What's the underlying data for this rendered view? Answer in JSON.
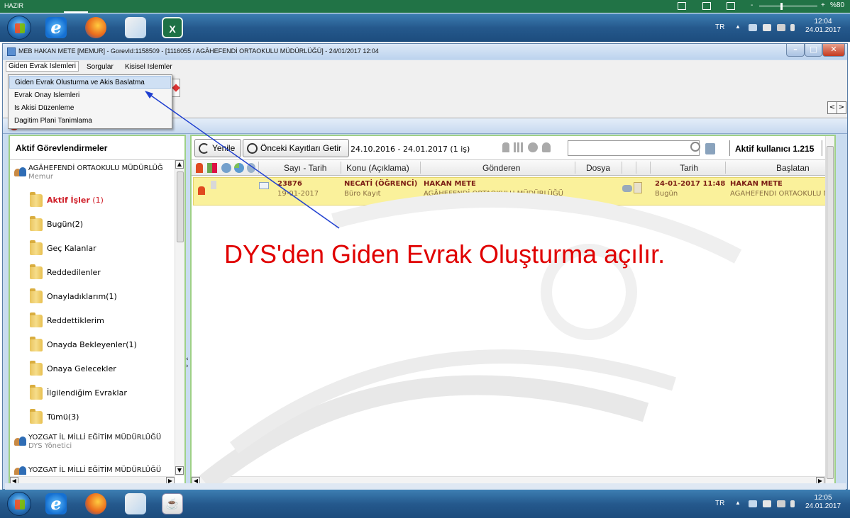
{
  "excel_status": {
    "ready": "HAZIR",
    "zoom": "%80"
  },
  "taskbar_top": {
    "lang": "TR",
    "time": "12:04",
    "date": "24.01.2017",
    "tray_caret": "▲"
  },
  "taskbar_bottom": {
    "lang": "TR",
    "time": "12:05",
    "date": "24.01.2017",
    "tray_caret": "▲"
  },
  "window": {
    "title": "MEB  HAKAN METE  [MEMUR] - GorevId:1158509 - [1116055 / AGÂHEFENDİ ORTAOKULU MÜDÜRLÜĞÜ] - 24/01/2017 12:04"
  },
  "menubar": {
    "items": [
      "Giden Evrak Islemleri",
      "Sorgular",
      "Kisisel Islemler"
    ]
  },
  "dropdown": {
    "items": [
      "Giden Evrak Olusturma ve Akis Baslatma",
      "Evrak Onay Islemleri",
      "Is Akisi Düzenleme",
      "Dagitim Plani Tanimlama"
    ]
  },
  "left_panel": {
    "title": "Aktif Görevlendirmeler",
    "unit_1": {
      "name": "AGÂHEFENDİ ORTAOKULU MÜDÜRLÜĞ",
      "role": "Memur"
    },
    "folders": [
      {
        "label": "Aktif İşler",
        "count": "(1)"
      },
      {
        "label": "Bugün(2)"
      },
      {
        "label": "Geç Kalanlar"
      },
      {
        "label": "Reddedilenler"
      },
      {
        "label": "Onayladıklarım(1)"
      },
      {
        "label": "Reddettiklerim"
      },
      {
        "label": "Onayda Bekleyenler(1)"
      },
      {
        "label": "Onaya Gelecekler"
      },
      {
        "label": "İlgilendiğim Evraklar"
      },
      {
        "label": "Tümü(3)"
      }
    ],
    "unit_2": {
      "name": "YOZGAT İL MİLLİ EĞİTİM MÜDÜRLÜĞÜ",
      "role": "DYS Yönetici"
    },
    "unit_3": {
      "name": "YOZGAT İL MİLLİ EĞİTİM MÜDÜRLÜĞÜ"
    }
  },
  "right_panel": {
    "refresh_label": "Yenile",
    "prev_records_label": "Önceki Kayıtları Getir",
    "date_range": "24.10.2016 - 24.01.2017 (1 iş)",
    "active_users": "Aktif kullanıcı 1.215",
    "columns": [
      "Sayı - Tarih",
      "Konu (Açıklama)",
      "Gönderen",
      "Dosya",
      "Tarih",
      "Başlatan"
    ],
    "row": {
      "number": "23876",
      "number_date": "19-01-2017",
      "subject": "NECATİ  (ÖĞRENCİ)",
      "subject_sub": "Büro Kayıt",
      "sender": "HAKAN METE",
      "sender_unit": "AGÂHEFENDİ ORTAOKULU MÜDÜRLÜĞÜ",
      "date": "24-01-2017 11:48",
      "date_sub": "Bugün",
      "starter": "HAKAN METE",
      "starter_unit": "AGÂHEFENDİ ORTAOKULU M"
    }
  },
  "annotation": {
    "text": "DYS'den Giden Evrak Oluşturma açılır.",
    "color": "#e00000"
  },
  "colors": {
    "excel_green": "#217346",
    "row_highlight": "#faf19b",
    "panel_border": "#9ed087",
    "arrow": "#1f3fd0"
  }
}
